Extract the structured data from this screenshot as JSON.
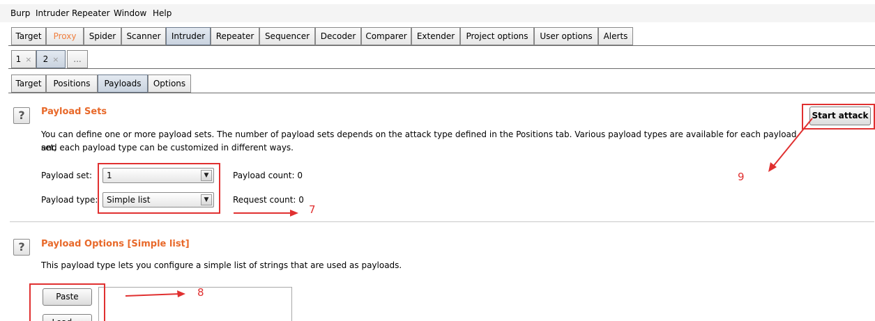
{
  "menu": [
    "Burp",
    "Intruder",
    "Repeater",
    "Window",
    "Help"
  ],
  "main_tabs": [
    "Target",
    "Proxy",
    "Spider",
    "Scanner",
    "Intruder",
    "Repeater",
    "Sequencer",
    "Decoder",
    "Comparer",
    "Extender",
    "Project options",
    "User options",
    "Alerts"
  ],
  "attack_tabs": [
    {
      "label": "1",
      "close": "×"
    },
    {
      "label": "2",
      "close": "×"
    },
    {
      "label": "..."
    }
  ],
  "sub_tabs": [
    "Target",
    "Positions",
    "Payloads",
    "Options"
  ],
  "payload_sets": {
    "help": "?",
    "title": "Payload Sets",
    "description_line1": "You can define one or more payload sets. The number of payload sets depends on the attack type defined in the Positions tab. Various payload types are available for each payload set,",
    "description_line2": "and each payload type can be customized in different ways.",
    "set_label": "Payload set:",
    "set_value": "1",
    "type_label": "Payload type:",
    "type_value": "Simple list",
    "payload_count": "Payload count:  0",
    "request_count": "Request count:  0",
    "start_attack": "Start attack"
  },
  "payload_options": {
    "help": "?",
    "title": "Payload Options [Simple list]",
    "description": "This payload type lets you configure a simple list of strings that are used as payloads.",
    "paste": "Paste",
    "load": "Load ..."
  },
  "annotations": {
    "a7": "7",
    "a8": "8",
    "a9": "9"
  },
  "colors": {
    "accent": "#e8692a",
    "annotation": "#e03030"
  }
}
